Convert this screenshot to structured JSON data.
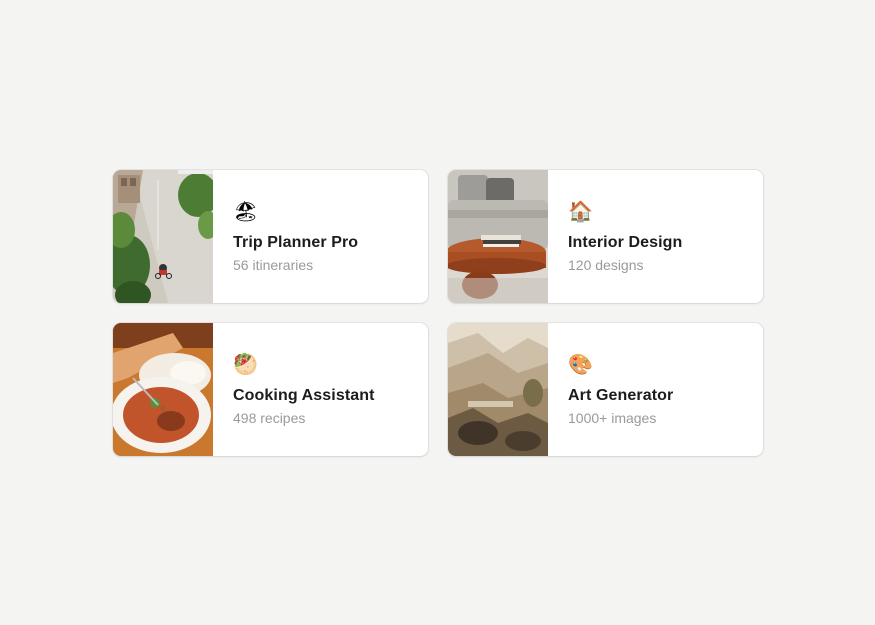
{
  "cards": [
    {
      "emoji": "🏖",
      "title": "Trip Planner Pro",
      "subtitle": "56 itineraries",
      "image": "street-scene-photo",
      "icon": "beach-umbrella-icon"
    },
    {
      "emoji": "🏠",
      "title": "Interior Design",
      "subtitle": "120 designs",
      "image": "living-room-photo",
      "icon": "house-icon"
    },
    {
      "emoji": "🥙",
      "title": "Cooking Assistant",
      "subtitle": "498 recipes",
      "image": "soup-bowl-photo",
      "icon": "food-icon"
    },
    {
      "emoji": "🎨",
      "title": "Art Generator",
      "subtitle": "1000+ images",
      "image": "landscape-painting-photo",
      "icon": "palette-icon"
    }
  ]
}
